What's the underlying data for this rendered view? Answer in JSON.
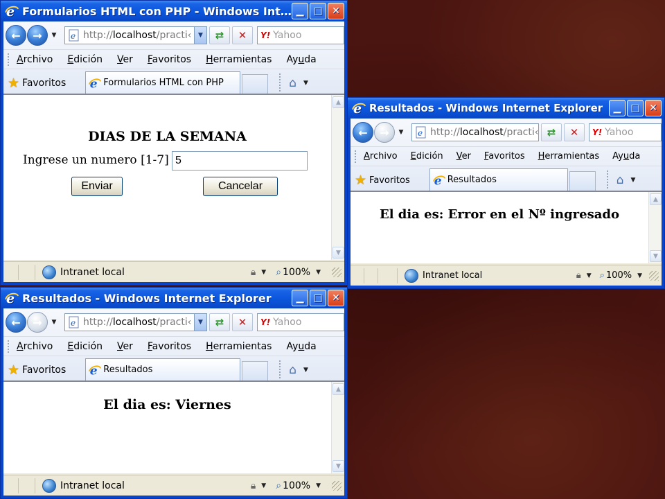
{
  "browser": {
    "back_icon": "back-arrow-icon",
    "forward_icon": "forward-arrow-icon",
    "url_scheme": "http://",
    "url_host": "localhost",
    "url_rest": "/practi‹",
    "search_placeholder": "Yahoo",
    "search_logo": "Y!",
    "menu": [
      {
        "u": "A",
        "rest": "rchivo"
      },
      {
        "pre": "",
        "u": "E",
        "rest": "dición"
      },
      {
        "u": "V",
        "rest": "er"
      },
      {
        "u": "F",
        "rest": "avoritos"
      },
      {
        "u": "H",
        "rest": "erramientas"
      },
      {
        "pre": "Ay",
        "u": "u",
        "rest": "da"
      }
    ],
    "favorites_label": "Favoritos",
    "zone_label": "Intranet local",
    "zoom_label": "100%"
  },
  "windows": {
    "form": {
      "title": "Formularios HTML con PHP - Windows Int…",
      "tab_label": "Formularios HTML con PHP",
      "heading": "DIAS DE LA SEMANA",
      "field_label": "Ingrese un numero [1-7] :",
      "field_value": "5",
      "submit_label": "Enviar",
      "cancel_label": "Cancelar"
    },
    "error": {
      "title": "Resultados - Windows Internet Explorer",
      "tab_label": "Resultados",
      "message": "El dia es: Error en el Nº ingresado"
    },
    "viernes": {
      "title": "Resultados - Windows Internet Explorer",
      "tab_label": "Resultados",
      "message": "El dia es: Viernes"
    }
  },
  "colors": {
    "titlebar": "#0a56dc",
    "chrome": "#ece9d8",
    "desktop_bg": "#4a1410"
  }
}
